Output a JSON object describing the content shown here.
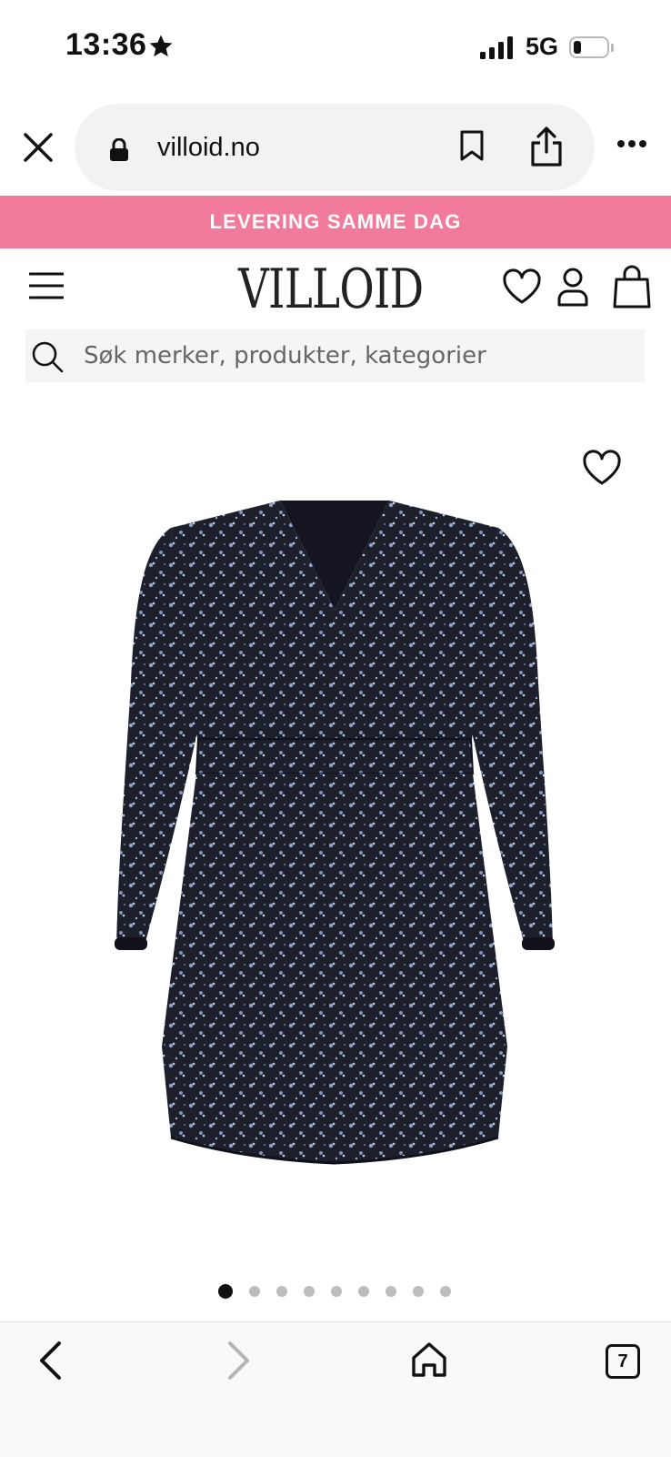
{
  "status_bar": {
    "time": "13:36",
    "network": "5G"
  },
  "browser": {
    "url": "villoid.no"
  },
  "promo_banner": {
    "text": "LEVERING SAMME DAG"
  },
  "site": {
    "logo": "VILLOID",
    "search": {
      "placeholder": "Søk merker, produkter, kategorier",
      "value": ""
    }
  },
  "product": {
    "image_count": 9,
    "active_image": 1
  },
  "toolbar": {
    "tab_count": "7"
  },
  "colors": {
    "promo": "#f27b9c",
    "text": "#111111",
    "search_bg": "#f5f5f5"
  },
  "icons": [
    "close-icon",
    "lock-icon",
    "bookmark-icon",
    "share-icon",
    "more-icon",
    "menu-icon",
    "heart-icon",
    "user-icon",
    "bag-icon",
    "search-icon",
    "back-icon",
    "forward-icon",
    "home-icon",
    "tabs-icon"
  ]
}
